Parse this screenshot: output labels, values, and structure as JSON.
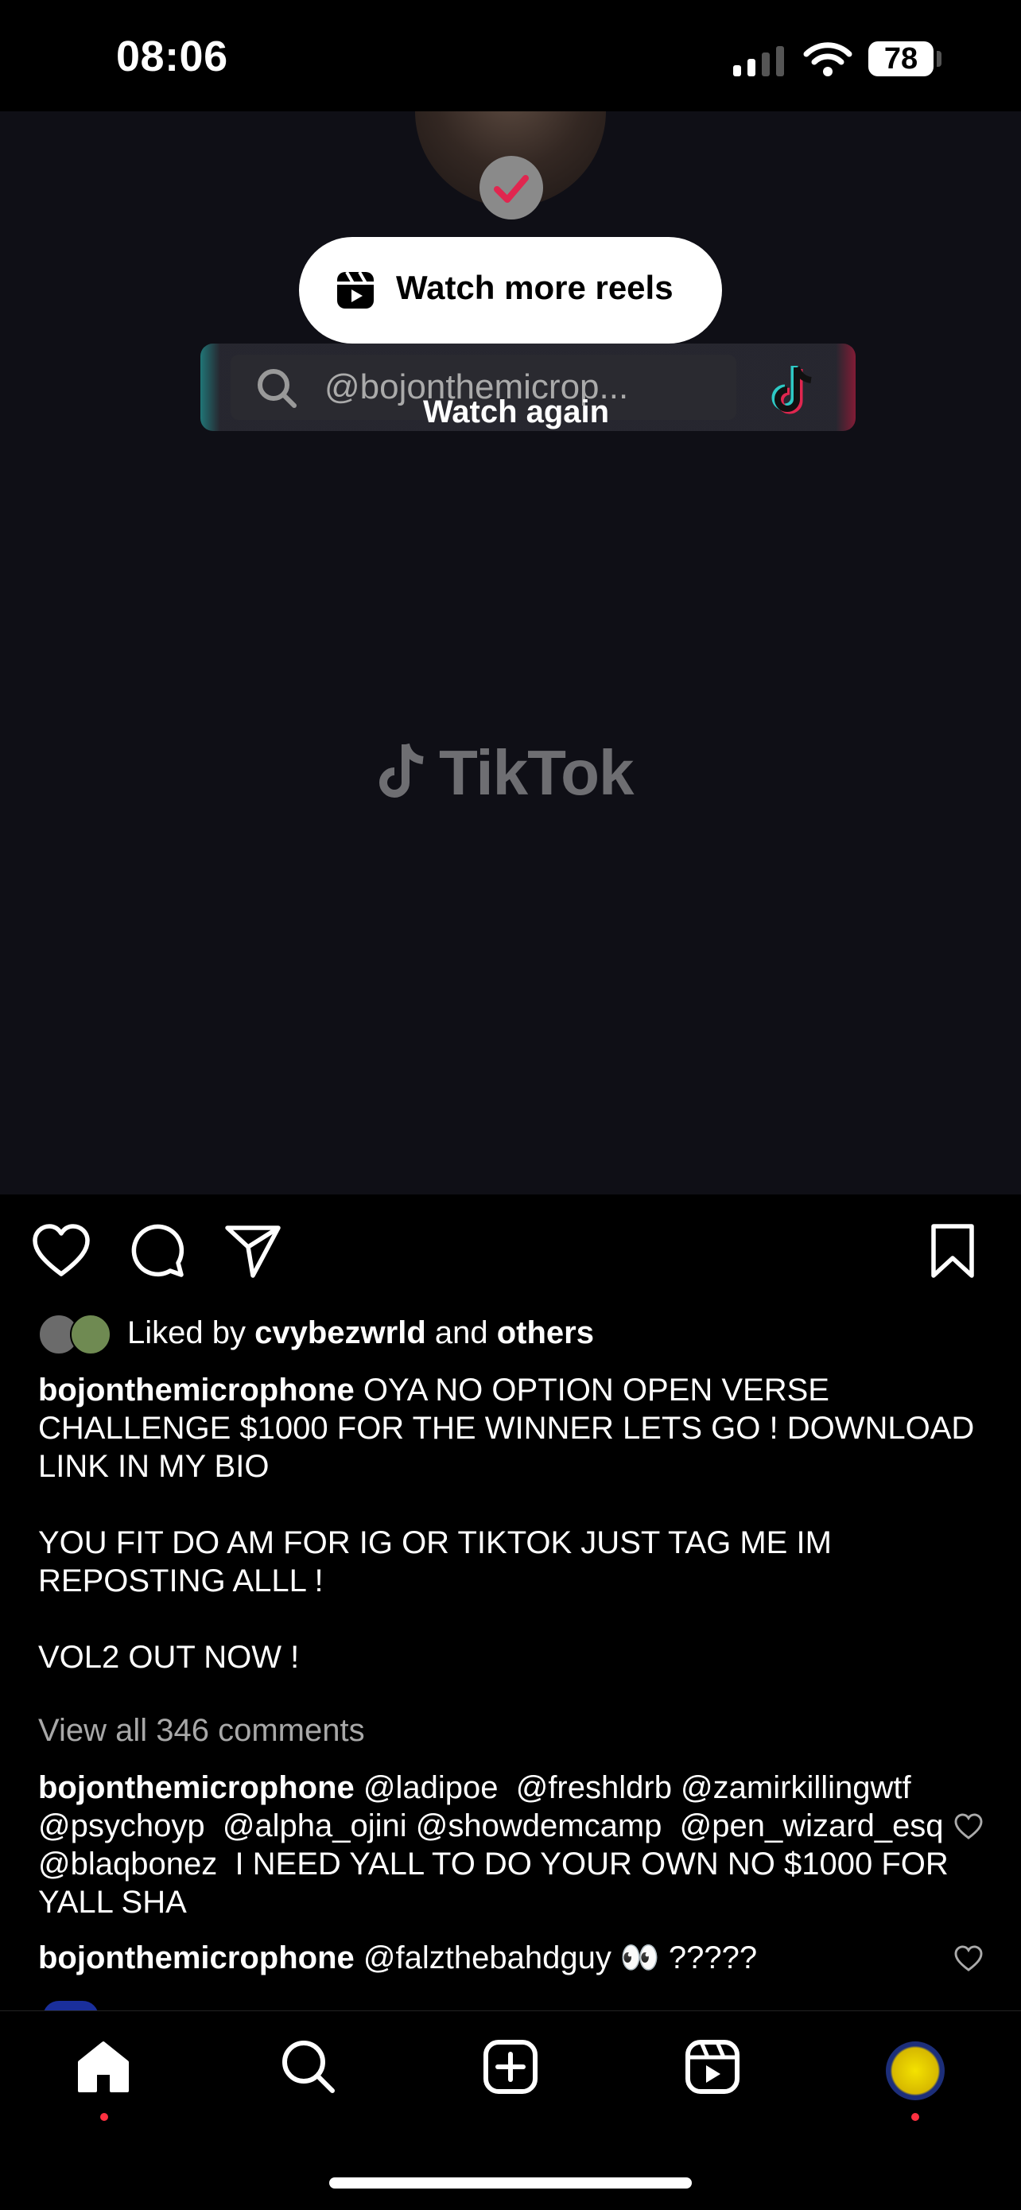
{
  "status_bar": {
    "time": "08:06",
    "battery": "78"
  },
  "video": {
    "watch_more_reels": "Watch more reels",
    "tiktok_search_text": "@bojonthemicrop...",
    "watch_again": "Watch again",
    "tiktok_brand": "TikTok"
  },
  "likes": {
    "prefix": "Liked by ",
    "user": "cvybezwrld",
    "middle": " and ",
    "others": "others"
  },
  "caption": {
    "username": "bojonthemicrophone",
    "text": " OYA NO OPTION OPEN VERSE CHALLENGE $1000 FOR THE WINNER LETS GO ! DOWNLOAD LINK IN MY BIO\n\nYOU FIT DO AM FOR IG OR TIKTOK JUST TAG ME IM REPOSTING ALLL !\n\nVOL2 OUT NOW !"
  },
  "comments": {
    "view_all": "View all 346 comments",
    "items": [
      {
        "username": "bojonthemicrophone",
        "text": " @ladipoe  @freshldrb @zamirkillingwtf @psychoyp  @alpha_ojini @showdemcamp  @pen_wizard_esq  @blaqbonez  I NEED YALL TO DO YOUR OWN NO $1000 FOR YALL SHA"
      },
      {
        "username": "bojonthemicrophone",
        "text": " @falzthebahdguy 👀 ?????"
      }
    ]
  },
  "icons": [
    "heart-icon",
    "comment-icon",
    "share-icon",
    "bookmark-icon",
    "home-icon",
    "search-icon",
    "create-icon",
    "reels-icon"
  ],
  "colors": {
    "notification_dot": "#ff3040",
    "background": "#000000"
  }
}
